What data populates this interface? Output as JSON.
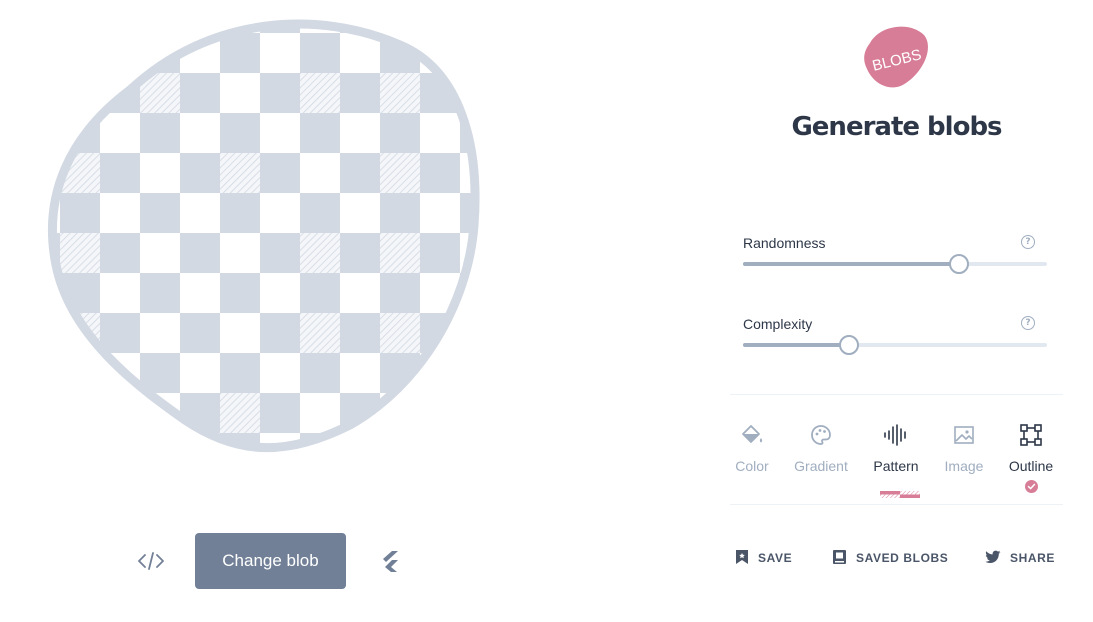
{
  "logo": {
    "text": "BLOBS",
    "color": "#d77d97"
  },
  "title": "Generate blobs",
  "sliders": [
    {
      "label": "Randomness",
      "value_fraction": 0.71
    },
    {
      "label": "Complexity",
      "value_fraction": 0.35
    }
  ],
  "tabs": [
    {
      "label": "Color",
      "icon": "paint-bucket-icon"
    },
    {
      "label": "Gradient",
      "icon": "palette-icon"
    },
    {
      "label": "Pattern",
      "icon": "waveform-icon"
    },
    {
      "label": "Image",
      "icon": "image-icon"
    },
    {
      "label": "Outline",
      "icon": "outline-frame-icon"
    }
  ],
  "selected_tab": "Pattern",
  "outline_enabled": true,
  "buttons": {
    "change_blob": "Change blob"
  },
  "actions": [
    {
      "label": "SAVE",
      "icon": "bookmark-icon"
    },
    {
      "label": "SAVED BLOBS",
      "icon": "book-icon"
    },
    {
      "label": "SHARE",
      "icon": "twitter-icon"
    }
  ],
  "colors": {
    "blob_fill": "#d2d9e3",
    "accent": "#d77d97",
    "button": "#718096",
    "title": "#2d3748",
    "muted": "#a0aec0"
  }
}
